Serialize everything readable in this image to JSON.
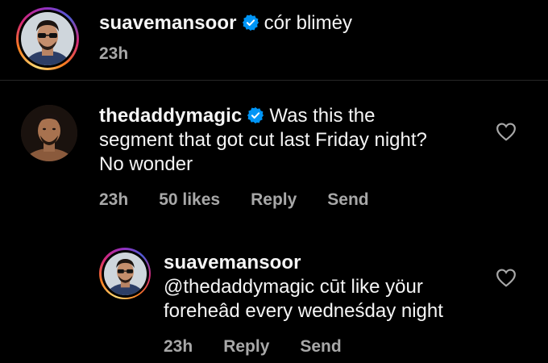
{
  "caption": {
    "username": "suavemansoor",
    "verified": true,
    "text": "cór blimėy",
    "time": "23h"
  },
  "comment": {
    "username": "thedaddymagic",
    "verified": true,
    "text_line1": "Was this the",
    "text_line2": "segment that got cut last Friday night?",
    "text_line3": "No wonder",
    "time": "23h",
    "likes": "50 likes",
    "reply_label": "Reply",
    "send_label": "Send",
    "like_icon": "heart-outline-icon"
  },
  "reply": {
    "username": "suavemansoor",
    "text_line1": "@thedaddymagic cūt like yöur",
    "text_line2": "foreheâd every wedneśday night",
    "time": "23h",
    "reply_label": "Reply",
    "send_label": "Send",
    "like_icon": "heart-outline-icon"
  },
  "colors": {
    "background": "#000000",
    "text": "#f5f5f5",
    "meta": "#a8a8a8",
    "verified": "#0095f6"
  }
}
